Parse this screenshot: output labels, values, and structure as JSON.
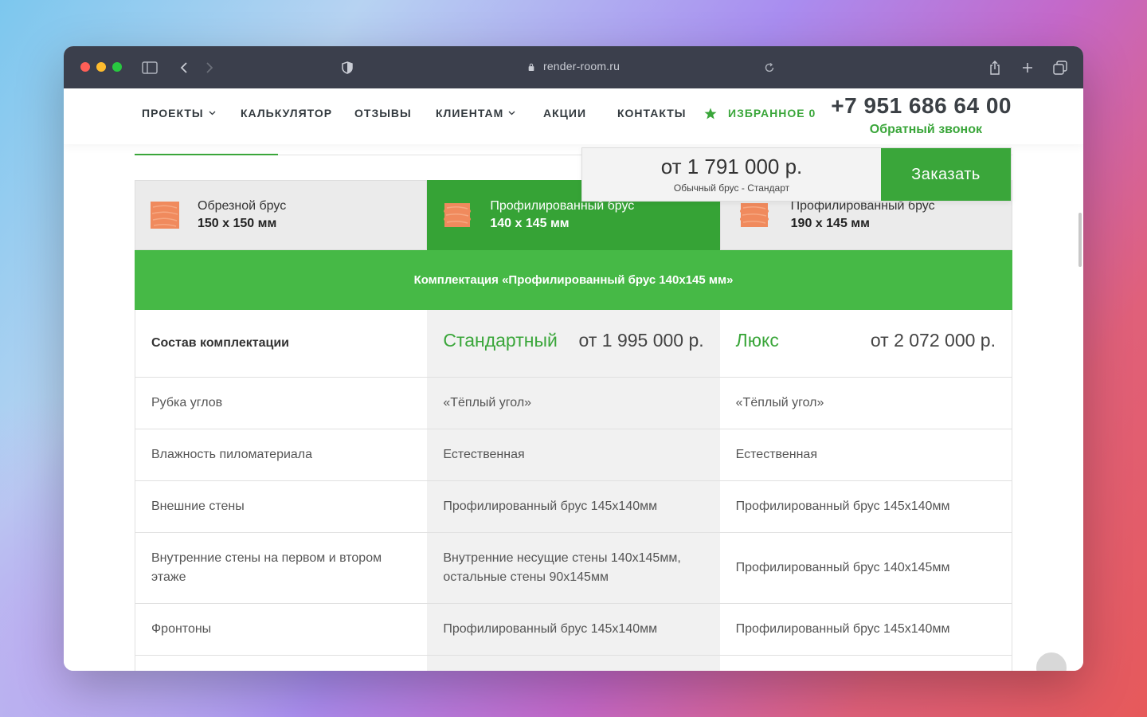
{
  "browser": {
    "url": "render-room.ru"
  },
  "nav": {
    "items": [
      {
        "label": "ПРОЕКТЫ"
      },
      {
        "label": "КАЛЬКУЛЯТОР"
      },
      {
        "label": "ОТЗЫВЫ"
      },
      {
        "label": "КЛИЕНТАМ"
      },
      {
        "label": "АКЦИИ"
      },
      {
        "label": "КОНТАКТЫ"
      }
    ],
    "favorites_label": "ИЗБРАННОЕ 0",
    "phone": "+7 951 686 64 00",
    "callback": "Обратный звонок"
  },
  "sticky": {
    "price": "от 1 791 000 р.",
    "subtitle": "Обычный брус - Стандарт",
    "order_button": "Заказать"
  },
  "material_tabs": [
    {
      "line1": "Обрезной брус",
      "line2": "150 х 150 мм",
      "active": false
    },
    {
      "line1": "Профилированный брус",
      "line2": "140 х 145 мм",
      "active": true
    },
    {
      "line1": "Профилированный брус",
      "line2": "190 х 145 мм",
      "active": false
    }
  ],
  "banner": "Комплектация «Профилированный брус 140х145 мм»",
  "table": {
    "header": {
      "label": "Состав комплектации",
      "standard_name": "Стандартный",
      "standard_price": "от 1 995 000 р.",
      "lux_name": "Люкс",
      "lux_price": "от 2 072 000 р."
    },
    "rows": [
      {
        "label": "Рубка углов",
        "standard": "«Тёплый угол»",
        "lux": "«Тёплый угол»"
      },
      {
        "label": "Влажность пиломатериала",
        "standard": "Естественная",
        "lux": "Естественная"
      },
      {
        "label": "Внешние стены",
        "standard": "Профилированный брус 145х140мм",
        "lux": "Профилированный брус 145х140мм"
      },
      {
        "label": "Внутренние стены на первом и втором этаже",
        "standard": "Внутренние несущие стены 140х145мм, остальные стены 90х145мм",
        "lux": "Профилированный брус 140х145мм"
      },
      {
        "label": "Фронтоны",
        "standard": "Профилированный брус 145х140мм",
        "lux": "Профилированный брус 145х140мм"
      }
    ]
  },
  "colors": {
    "brand_green": "#3aa63a",
    "banner_green": "#46b946",
    "timber_orange": "#f08a5d"
  }
}
